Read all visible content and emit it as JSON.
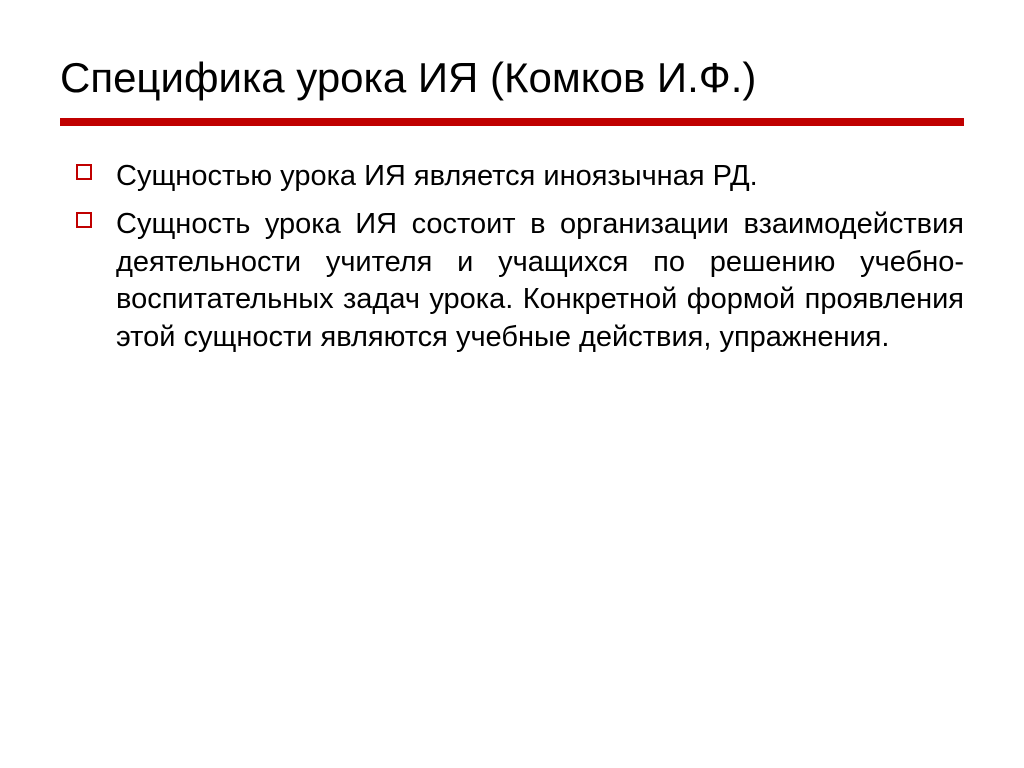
{
  "slide": {
    "title": "Специфика урока ИЯ (Комков И.Ф.)",
    "bullets": [
      "Сущностью урока ИЯ является иноязычная РД.",
      "Сущность урока ИЯ состоит в организации взаимодействия деятельности учителя и учащихся по решению учебно-воспитательных задач урока. Конкретной формой проявления этой сущности являются учебные действия, упражнения."
    ]
  },
  "colors": {
    "accent": "#c00000"
  }
}
